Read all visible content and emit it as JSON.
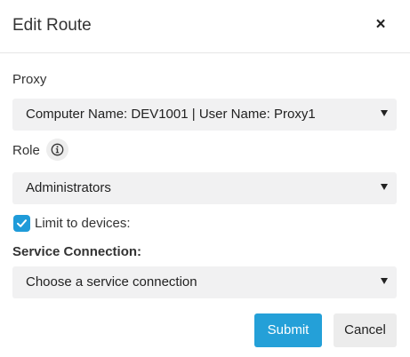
{
  "dialog": {
    "title": "Edit Route",
    "close_glyph": "×"
  },
  "proxy": {
    "label": "Proxy",
    "value": "Computer Name: DEV1001 | User Name: Proxy1"
  },
  "role": {
    "label": "Role",
    "info_icon": "info-icon",
    "value": "Administrators"
  },
  "limit": {
    "label": "Limit to devices:",
    "checked": true
  },
  "service_connection": {
    "label": "Service Connection:",
    "placeholder": "Choose a service connection"
  },
  "actions": {
    "submit_label": "Submit",
    "cancel_label": "Cancel"
  },
  "colors": {
    "accent": "#24a0d8",
    "select_bg": "#f1f1f2",
    "cancel_bg": "#ececec"
  }
}
